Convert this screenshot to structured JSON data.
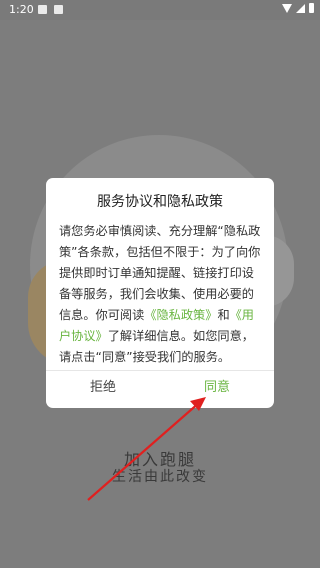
{
  "status_bar": {
    "time": "1:20"
  },
  "background": {
    "title": "加入跑腿",
    "subtitle": "生活由此改变"
  },
  "dialog": {
    "title": "服务协议和隐私政策",
    "body_part1": "请您务必审慎阅读、充分理解“隐私政策”各条款，包括但不限于：为了向你提供即时订单通知提醒、链接打印设备等服务，我们会收集、使用必要的信息。你可阅读",
    "privacy_link": "《隐私政策》",
    "body_and": "和",
    "user_link": "《用户协议》",
    "body_part2": "了解详细信息。如您同意，请点击“同意”接受我们的服务。",
    "refuse_label": "拒绝",
    "agree_label": "同意"
  },
  "colors": {
    "accent": "#69b540",
    "annotation": "#e0201f"
  }
}
